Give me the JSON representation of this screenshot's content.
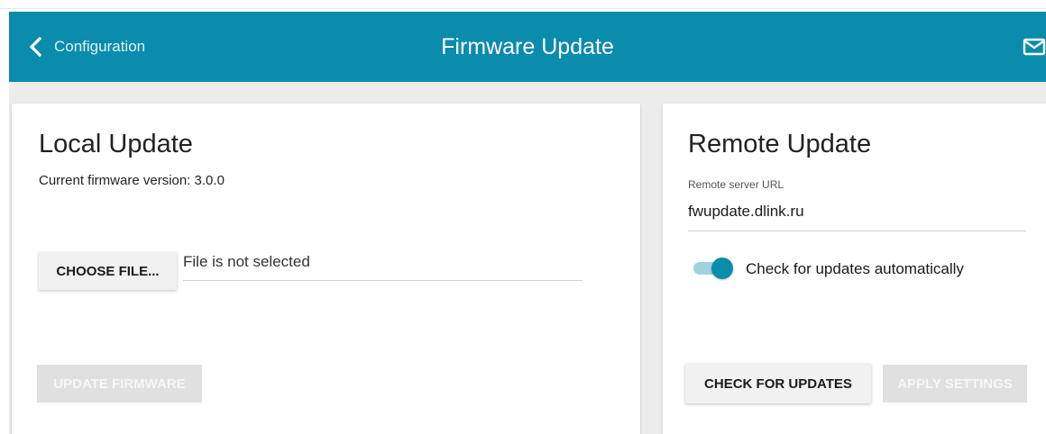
{
  "header": {
    "back_label": "Configuration",
    "title": "Firmware Update",
    "back_icon": "chevron-left-icon",
    "notifications_icon": "mail-icon",
    "color": "#0a8cad"
  },
  "local_update": {
    "heading": "Local Update",
    "firmware_version": "Current firmware version: 3.0.0",
    "choose_file_label": "CHOOSE FILE...",
    "file_status": "File is not selected",
    "update_button_label": "UPDATE FIRMWARE",
    "update_button_enabled": false
  },
  "remote_update": {
    "heading": "Remote Update",
    "url_label": "Remote server URL",
    "url_value": "fwupdate.dlink.ru",
    "auto_check_label": "Check for updates automatically",
    "auto_check_on": true,
    "check_button_label": "CHECK FOR UPDATES",
    "apply_button_label": "APPLY SETTINGS",
    "apply_button_enabled": false
  }
}
